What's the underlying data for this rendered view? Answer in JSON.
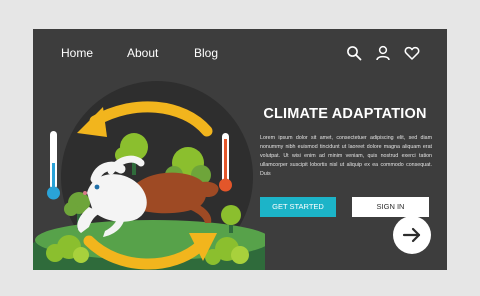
{
  "nav": {
    "links": [
      "Home",
      "About",
      "Blog"
    ],
    "icons": [
      "search-icon",
      "user-icon",
      "heart-icon"
    ]
  },
  "hero": {
    "title": "CLIMATE ADAPTATION",
    "body": "Lorem ipsum dolor sit amet, consectetuer adipiscing elit, sed diam nonummy nibh euismod tincidunt ut laoreet dolore magna aliquam erat volutpat. Ut wisi enim ad minim veniam, quis nostrud exerci tation ullamcorper suscipit lobortis nisl ut aliquip ex ea commodo consequat. Duis",
    "primary_button": "GET STARTED",
    "secondary_button": "SIGN IN"
  },
  "illustration": {
    "subject": "hare-icon",
    "cold_thermometer": "thermometer-cold-icon",
    "hot_thermometer": "thermometer-hot-icon"
  },
  "colors": {
    "frame_bg": "#3d3d3d",
    "accent_primary": "#1cb4c8",
    "arrow_yellow": "#f2b51d",
    "leaf_green": "#8bbf2e",
    "thermo_hot": "#e3562a",
    "thermo_cold": "#2aa3d8"
  },
  "next_icon": "arrow-right-icon"
}
